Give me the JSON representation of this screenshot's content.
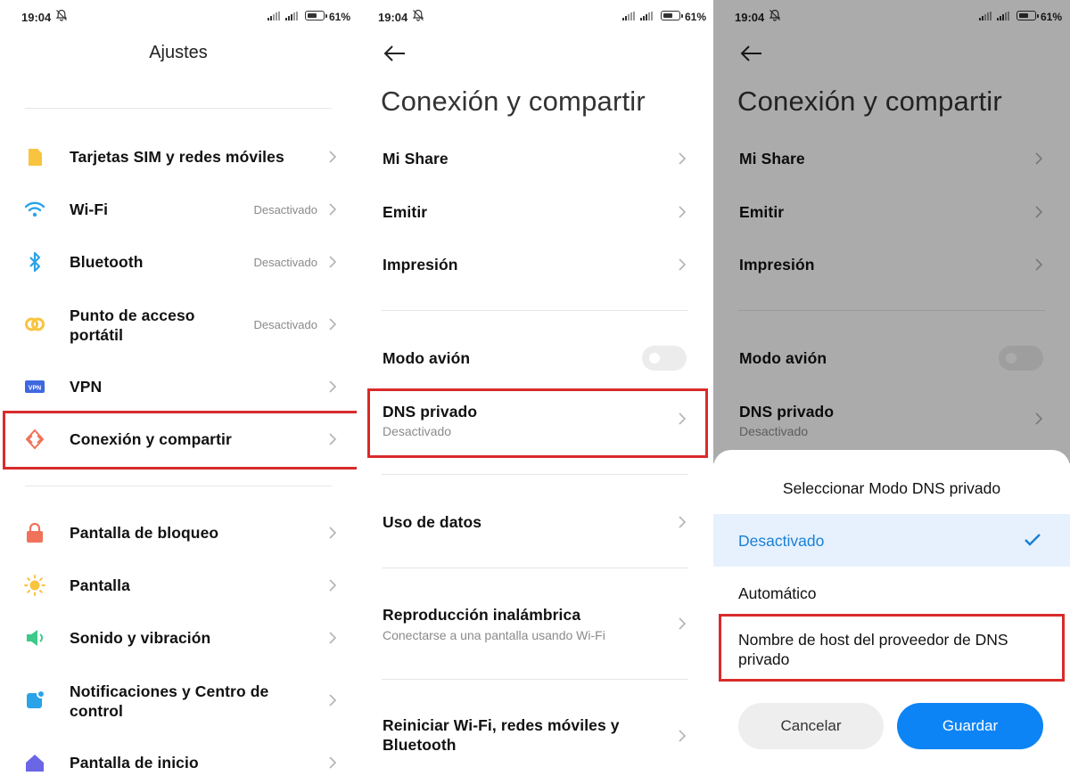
{
  "status": {
    "time": "19:04",
    "battery": "61%"
  },
  "panel1": {
    "title": "Ajustes",
    "items": [
      {
        "label": "Tarjetas SIM y redes móviles",
        "value": ""
      },
      {
        "label": "Wi-Fi",
        "value": "Desactivado"
      },
      {
        "label": "Bluetooth",
        "value": "Desactivado"
      },
      {
        "label": "Punto de acceso\nportátil",
        "value": "Desactivado"
      },
      {
        "label": "VPN",
        "value": "",
        "badge": "VPN"
      },
      {
        "label": "Conexión y compartir",
        "value": ""
      },
      {
        "label": "Pantalla de bloqueo",
        "value": ""
      },
      {
        "label": "Pantalla",
        "value": ""
      },
      {
        "label": "Sonido y vibración",
        "value": ""
      },
      {
        "label": "Notificaciones y Centro de\ncontrol",
        "value": ""
      },
      {
        "label": "Pantalla de inicio",
        "value": ""
      }
    ],
    "icons": [
      "sim-icon",
      "wifi-icon",
      "bluetooth-icon",
      "hotspot-icon",
      "vpn-icon",
      "connection-share-icon",
      "lock-icon",
      "sun-icon",
      "speaker-icon",
      "notification-icon",
      "home-icon"
    ]
  },
  "panel2": {
    "title": "Conexión y compartir",
    "items": [
      {
        "label": "Mi Share"
      },
      {
        "label": "Emitir"
      },
      {
        "label": "Impresión"
      },
      {
        "label": "Modo avión",
        "toggle": false
      },
      {
        "label": "DNS privado",
        "sub": "Desactivado"
      },
      {
        "label": "Uso de datos"
      },
      {
        "label": "Reproducción inalámbrica",
        "sub": "Conectarse a una pantalla usando Wi-Fi"
      },
      {
        "label": "Reiniciar Wi-Fi, redes móviles y\nBluetooth"
      }
    ]
  },
  "panel3": {
    "title": "Conexión y compartir",
    "items": [
      {
        "label": "Mi Share"
      },
      {
        "label": "Emitir"
      },
      {
        "label": "Impresión"
      },
      {
        "label": "Modo avión",
        "toggle": false
      },
      {
        "label": "DNS privado",
        "sub": "Desactivado"
      }
    ],
    "sheet": {
      "title": "Seleccionar Modo DNS privado",
      "options": [
        {
          "label": "Desactivado",
          "selected": true
        },
        {
          "label": "Automático",
          "selected": false
        },
        {
          "label": "Nombre de host del proveedor de DNS\nprivado",
          "selected": false
        }
      ],
      "cancel": "Cancelar",
      "save": "Guardar"
    }
  },
  "colors": {
    "accent": "#0d84f5",
    "highlight": "#d92b2b",
    "selected_bg": "#e6f1fd"
  }
}
